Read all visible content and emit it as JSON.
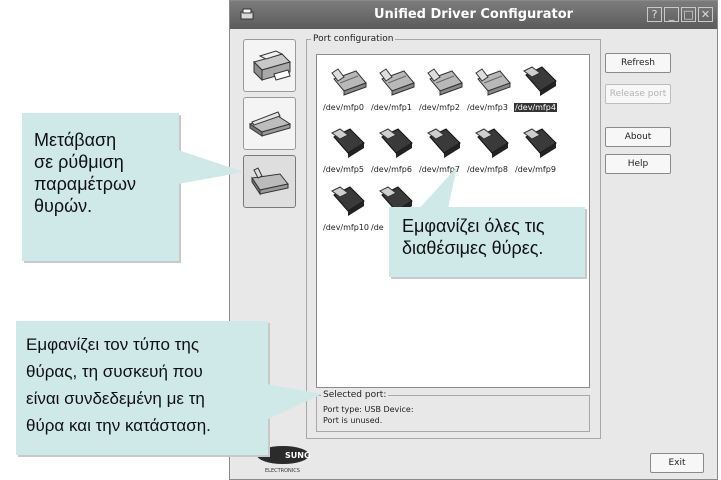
{
  "window": {
    "title": "Unified Driver Configurator",
    "controls": [
      "?",
      "_",
      "□",
      "✕"
    ]
  },
  "port_configuration": {
    "group_label": "Port configuration",
    "ports": [
      "/dev/mfp0",
      "/dev/mfp1",
      "/dev/mfp2",
      "/dev/mfp3",
      "/dev/mfp4",
      "/dev/mfp5",
      "/dev/mfp6",
      "/dev/mfp7",
      "/dev/mfp8",
      "/dev/mfp9",
      "/dev/mfp10",
      "/de"
    ],
    "selected_port": "/dev/mfp4",
    "selected": {
      "group_label": "Selected port:",
      "port_type_label": "Port type: USB   Device:",
      "status": "Port is unused."
    }
  },
  "buttons": {
    "refresh": "Refresh",
    "release_port": "Release port",
    "about": "About",
    "help": "Help",
    "exit": "Exit"
  },
  "logo": {
    "brand": "SUNG",
    "sub": "ELECTRONICS"
  },
  "callouts": {
    "left": "Μετάβαση\nσε ρύθμιση\nπαραμέτρων\nθυρών.",
    "center": "Εμφανίζει όλες τις\nδιαθέσιμες θύρες.",
    "bottom": "Εμφανίζει τον τύπο της\nθύρας, τη συσκευή που\nείναι συνδεδεμένη με τη\nθύρα και την κατάσταση."
  },
  "colors": {
    "callout_bg": "#cfe9e9",
    "titlebar": "#5b5b5b",
    "selection": "#333333"
  }
}
